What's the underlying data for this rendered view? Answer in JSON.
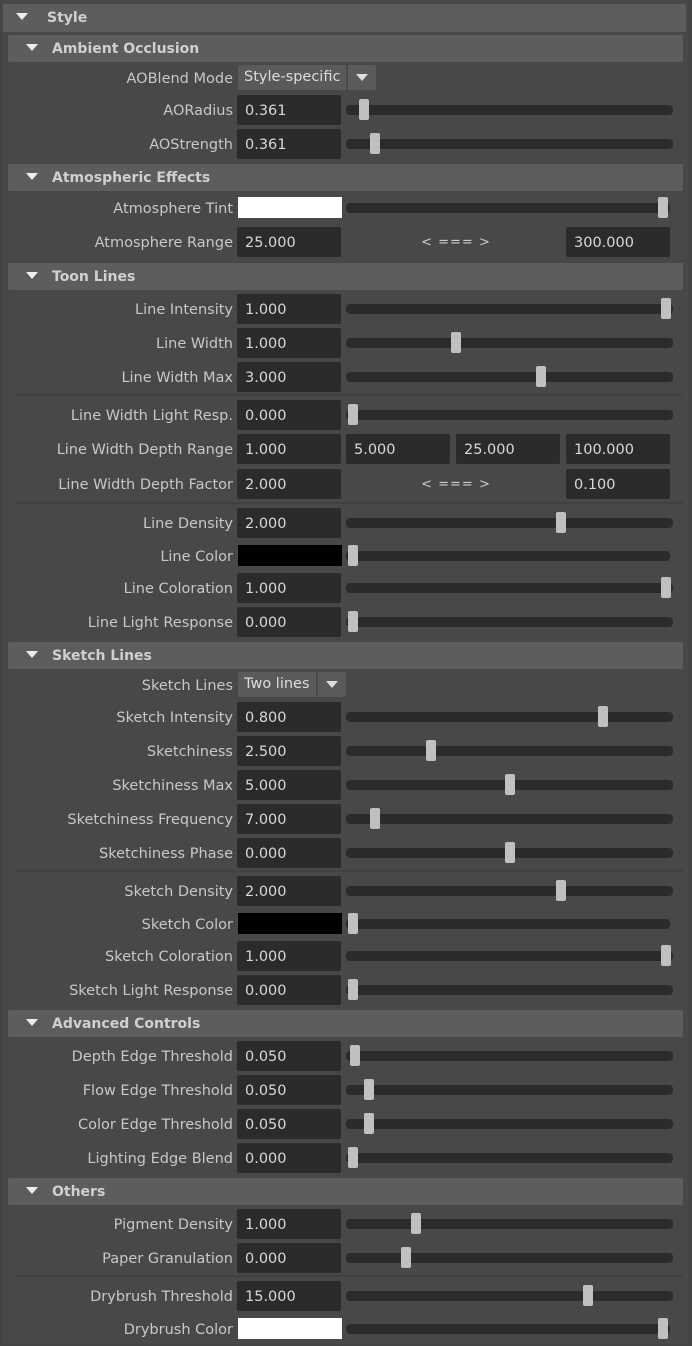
{
  "panel_title": "Style",
  "sections": {
    "ambient_occlusion": {
      "title": "Ambient Occlusion",
      "aoblend_mode": {
        "label": "AOBlend Mode",
        "value": "Style-specific"
      },
      "aoradius": {
        "label": "AORadius",
        "value": "0.361",
        "slider": 0.035
      },
      "aostrength": {
        "label": "AOStrength",
        "value": "0.361",
        "slider": 0.07
      }
    },
    "atmospheric_effects": {
      "title": "Atmospheric Effects",
      "atmosphere_tint": {
        "label": "Atmosphere Tint",
        "color": "#ffffff",
        "slider": 1.0
      },
      "atmosphere_range": {
        "label": "Atmosphere Range",
        "min": "25.000",
        "arrows": "< === >",
        "max": "300.000"
      }
    },
    "toon_lines": {
      "title": "Toon Lines",
      "line_intensity": {
        "label": "Line Intensity",
        "value": "1.000",
        "slider": 1.0
      },
      "line_width": {
        "label": "Line Width",
        "value": "1.000",
        "slider": 0.33
      },
      "line_width_max": {
        "label": "Line Width Max",
        "value": "3.000",
        "slider": 0.6
      },
      "line_width_light_resp": {
        "label": "Line Width Light Resp.",
        "value": "0.000",
        "slider": 0.0
      },
      "line_width_depth_range": {
        "label": "Line Width Depth Range",
        "values": [
          "1.000",
          "5.000",
          "25.000",
          "100.000"
        ]
      },
      "line_width_depth_factor": {
        "label": "Line Width Depth Factor",
        "min": "2.000",
        "arrows": "< === >",
        "max": "0.100"
      },
      "line_density": {
        "label": "Line Density",
        "value": "2.000",
        "slider": 0.665
      },
      "line_color": {
        "label": "Line Color",
        "color": "#000000",
        "slider": 0.0
      },
      "line_coloration": {
        "label": "Line Coloration",
        "value": "1.000",
        "slider": 1.0
      },
      "line_light_response": {
        "label": "Line Light Response",
        "value": "0.000",
        "slider": 0.0
      }
    },
    "sketch_lines": {
      "title": "Sketch Lines",
      "sketch_lines_mode": {
        "label": "Sketch Lines",
        "value": "Two lines"
      },
      "sketch_intensity": {
        "label": "Sketch Intensity",
        "value": "0.800",
        "slider": 0.8
      },
      "sketchiness": {
        "label": "Sketchiness",
        "value": "2.500",
        "slider": 0.25
      },
      "sketchiness_max": {
        "label": "Sketchiness Max",
        "value": "5.000",
        "slider": 0.5
      },
      "sketchiness_frequency": {
        "label": "Sketchiness Frequency",
        "value": "7.000",
        "slider": 0.07
      },
      "sketchiness_phase": {
        "label": "Sketchiness Phase",
        "value": "0.000",
        "slider": 0.5
      },
      "sketch_density": {
        "label": "Sketch Density",
        "value": "2.000",
        "slider": 0.665
      },
      "sketch_color": {
        "label": "Sketch Color",
        "color": "#000000",
        "slider": 0.0
      },
      "sketch_coloration": {
        "label": "Sketch Coloration",
        "value": "1.000",
        "slider": 1.0
      },
      "sketch_light_response": {
        "label": "Sketch Light Response",
        "value": "0.000",
        "slider": 0.0
      }
    },
    "advanced_controls": {
      "title": "Advanced Controls",
      "depth_edge_threshold": {
        "label": "Depth Edge Threshold",
        "value": "0.050",
        "slider": 0.005
      },
      "flow_edge_threshold": {
        "label": "Flow Edge Threshold",
        "value": "0.050",
        "slider": 0.05
      },
      "color_edge_threshold": {
        "label": "Color Edge Threshold",
        "value": "0.050",
        "slider": 0.05
      },
      "lighting_edge_blend": {
        "label": "Lighting Edge Blend",
        "value": "0.000",
        "slider": 0.0
      }
    },
    "others": {
      "title": "Others",
      "pigment_density": {
        "label": "Pigment Density",
        "value": "1.000",
        "slider": 0.2
      },
      "paper_granulation": {
        "label": "Paper Granulation",
        "value": "0.000",
        "slider": 0.17
      },
      "drybrush_threshold": {
        "label": "Drybrush Threshold",
        "value": "15.000",
        "slider": 0.75
      },
      "drybrush_color": {
        "label": "Drybrush Color",
        "color": "#ffffff",
        "slider": 1.0
      }
    }
  }
}
